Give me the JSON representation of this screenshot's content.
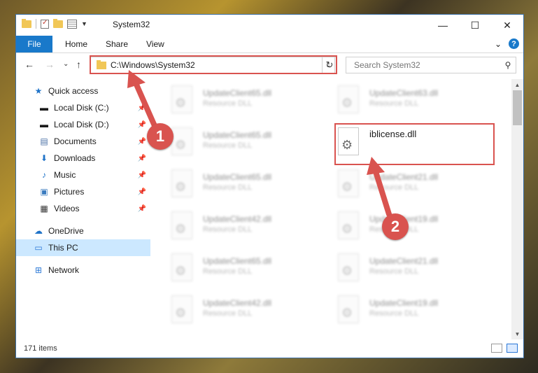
{
  "window": {
    "title": "System32",
    "caption": {
      "minimize": "—",
      "maximize": "☐",
      "close": "✕"
    }
  },
  "ribbon": {
    "tabs": [
      "File",
      "Home",
      "Share",
      "View"
    ],
    "expand": "⌄",
    "help": "?"
  },
  "nav": {
    "address": "C:\\Windows\\System32",
    "address_dropdown": "⌄",
    "refresh": "↻",
    "search_placeholder": "Search System32",
    "back": "←",
    "forward": "→",
    "recent": "⌄",
    "up": "↑"
  },
  "sidebar": {
    "items": [
      {
        "label": "Quick access",
        "icon": "star-icon",
        "pinned": false
      },
      {
        "label": "Local Disk (C:)",
        "icon": "drive-icon",
        "pinned": true
      },
      {
        "label": "Local Disk (D:)",
        "icon": "drive-icon",
        "pinned": true
      },
      {
        "label": "Documents",
        "icon": "documents-icon",
        "pinned": true
      },
      {
        "label": "Downloads",
        "icon": "download-icon",
        "pinned": true
      },
      {
        "label": "Music",
        "icon": "music-icon",
        "pinned": true
      },
      {
        "label": "Pictures",
        "icon": "pictures-icon",
        "pinned": true
      },
      {
        "label": "Videos",
        "icon": "videos-icon",
        "pinned": true
      },
      {
        "label": "OneDrive",
        "icon": "cloud-icon",
        "pinned": false
      },
      {
        "label": "This PC",
        "icon": "computer-icon",
        "pinned": false,
        "selected": true
      },
      {
        "label": "Network",
        "icon": "network-icon",
        "pinned": false
      }
    ]
  },
  "files": {
    "left": [
      {
        "name": "UpdateClient65.dll",
        "type": "Resource DLL"
      },
      {
        "name": "UpdateClient65.dll",
        "type": "Resource DLL"
      },
      {
        "name": "UpdateClient65.dll",
        "type": "Resource DLL"
      },
      {
        "name": "UpdateClient42.dll",
        "type": "Resource DLL"
      },
      {
        "name": "UpdateClient65.dll",
        "type": "Resource DLL"
      },
      {
        "name": "UpdateClient42.dll",
        "type": "Resource DLL"
      }
    ],
    "right": [
      {
        "name": "UpdateClient63.dll",
        "type": "Resource DLL"
      },
      {
        "name": "iblicense.dll",
        "type": ""
      },
      {
        "name": "UpdateClient21.dll",
        "type": "Resource DLL"
      },
      {
        "name": "UpdateClient19.dll",
        "type": "Resource DLL"
      },
      {
        "name": "UpdateClient21.dll",
        "type": "Resource DLL"
      },
      {
        "name": "UpdateClient19.dll",
        "type": "Resource DLL"
      }
    ]
  },
  "status": {
    "count": "171 items"
  },
  "annotations": {
    "step1": "1",
    "step2": "2",
    "color": "#d9534f"
  }
}
